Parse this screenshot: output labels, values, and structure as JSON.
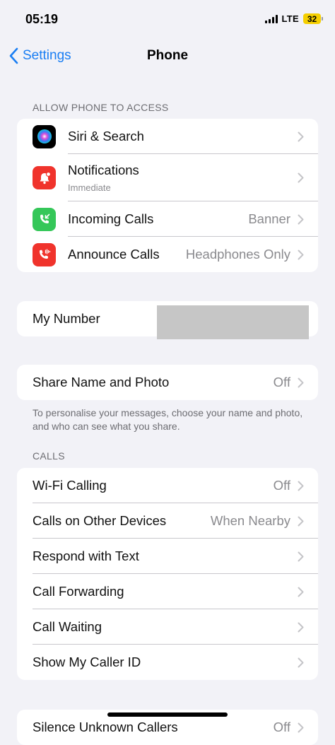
{
  "status_bar": {
    "time": "05:19",
    "network": "LTE",
    "battery": "32",
    "battery_color": "#f5cf00"
  },
  "nav": {
    "back_label": "Settings",
    "title": "Phone",
    "accent": "#1a7ef3"
  },
  "access": {
    "header": "ALLOW PHONE TO ACCESS",
    "rows": [
      {
        "icon": "siri-icon",
        "label": "Siri & Search",
        "value": ""
      },
      {
        "icon": "notifications-bell-icon",
        "label": "Notifications",
        "sublabel": "Immediate",
        "value": ""
      },
      {
        "icon": "incoming-call-icon",
        "label": "Incoming Calls",
        "value": "Banner"
      },
      {
        "icon": "announce-calls-icon",
        "label": "Announce Calls",
        "value": "Headphones Only"
      }
    ]
  },
  "my_number": {
    "label": "My Number"
  },
  "share": {
    "label": "Share Name and Photo",
    "value": "Off",
    "footer": "To personalise your messages, choose your name and photo, and who can see what you share."
  },
  "calls": {
    "header": "CALLS",
    "rows": [
      {
        "label": "Wi-Fi Calling",
        "value": "Off"
      },
      {
        "label": "Calls on Other Devices",
        "value": "When Nearby"
      },
      {
        "label": "Respond with Text",
        "value": ""
      },
      {
        "label": "Call Forwarding",
        "value": ""
      },
      {
        "label": "Call Waiting",
        "value": ""
      },
      {
        "label": "Show My Caller ID",
        "value": ""
      }
    ]
  },
  "partial_row": {
    "label": "Silence Unknown Callers",
    "value": "Off"
  }
}
